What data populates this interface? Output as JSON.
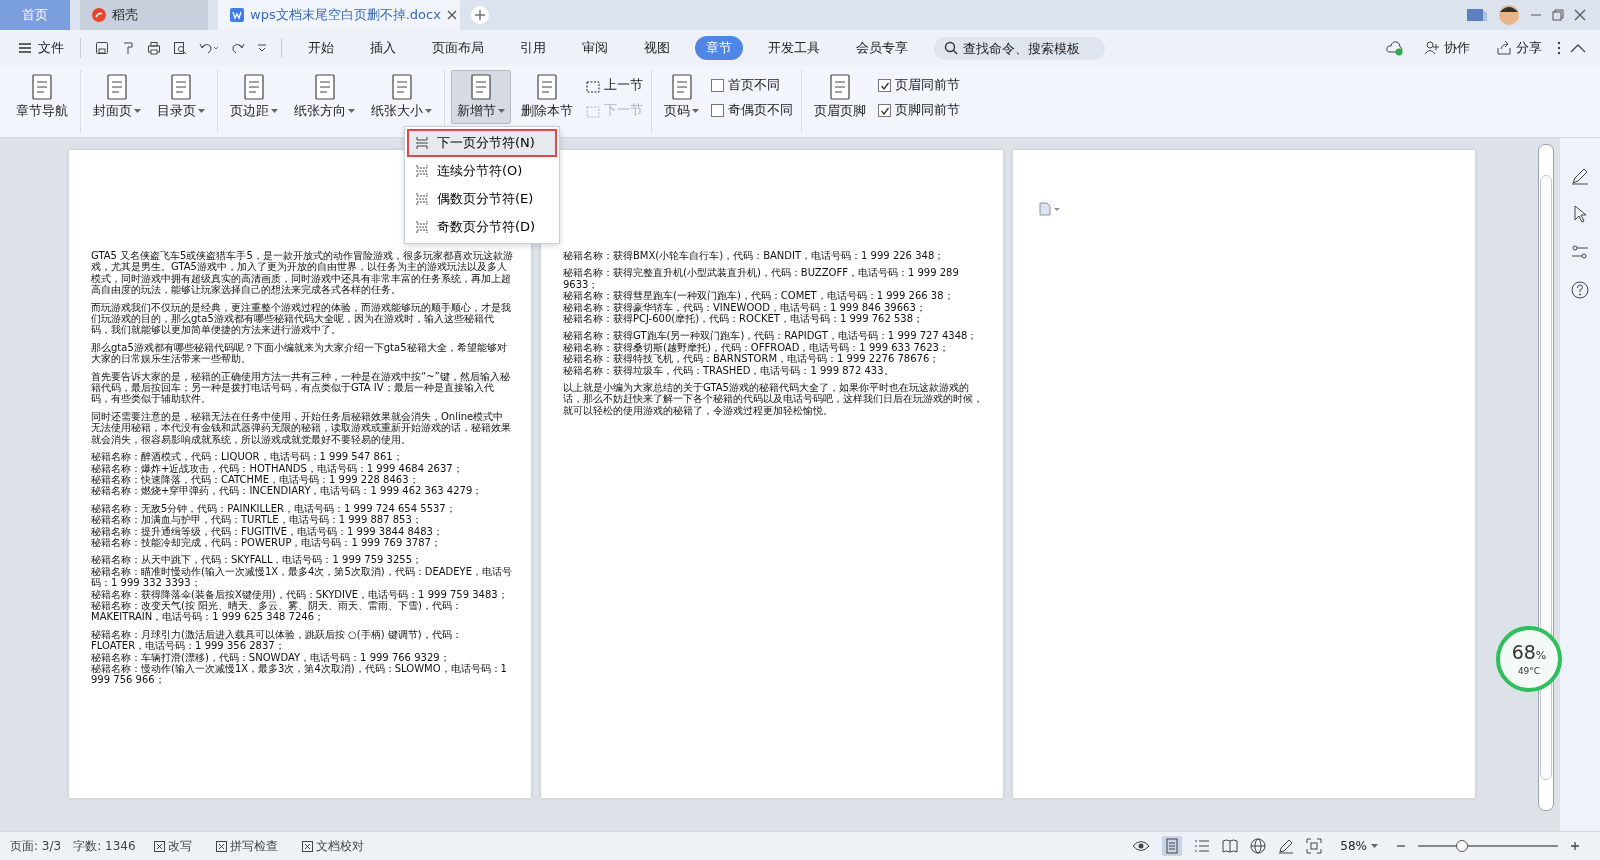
{
  "tabs": [
    {
      "label": "首页",
      "kind": "home",
      "selected": false
    },
    {
      "label": "稻壳",
      "kind": "app",
      "selected": false
    },
    {
      "label": "wps文档末尾空白页删不掉.docx",
      "kind": "doc",
      "selected": true
    }
  ],
  "file_menu": "文件",
  "menu_tabs": [
    {
      "label": "开始",
      "selected": false
    },
    {
      "label": "插入",
      "selected": false
    },
    {
      "label": "页面布局",
      "selected": false
    },
    {
      "label": "引用",
      "selected": false
    },
    {
      "label": "审阅",
      "selected": false
    },
    {
      "label": "视图",
      "selected": false
    },
    {
      "label": "章节",
      "selected": true
    },
    {
      "label": "开发工具",
      "selected": false
    },
    {
      "label": "会员专享",
      "selected": false
    }
  ],
  "search": {
    "placeholder": "查找命令、搜索模板"
  },
  "header_actions": [
    "协作",
    "分享"
  ],
  "ribbon": {
    "groups": [
      {
        "items": [
          {
            "kind": "big",
            "label": "章节导航",
            "dropdown": false,
            "pressed": false
          }
        ]
      },
      {
        "items": [
          {
            "kind": "big",
            "label": "封面页",
            "dropdown": true,
            "pressed": false
          },
          {
            "kind": "big",
            "label": "目录页",
            "dropdown": true,
            "pressed": false
          }
        ]
      },
      {
        "items": [
          {
            "kind": "big",
            "label": "页边距",
            "dropdown": true,
            "pressed": false
          },
          {
            "kind": "big",
            "label": "纸张方向",
            "dropdown": true,
            "pressed": false
          },
          {
            "kind": "big",
            "label": "纸张大小",
            "dropdown": true,
            "pressed": false
          }
        ]
      },
      {
        "items": [
          {
            "kind": "big",
            "label": "新增节",
            "dropdown": true,
            "pressed": true
          },
          {
            "kind": "big",
            "label": "删除本节",
            "dropdown": false,
            "pressed": false
          },
          {
            "kind": "stack",
            "items": [
              {
                "label": "上一节",
                "disabled": false
              },
              {
                "label": "下一节",
                "disabled": true
              }
            ]
          }
        ]
      },
      {
        "items": [
          {
            "kind": "big",
            "label": "页码",
            "dropdown": true,
            "pressed": false
          },
          {
            "kind": "checks",
            "items": [
              {
                "label": "首页不同",
                "checked": false
              },
              {
                "label": "奇偶页不同",
                "checked": false
              }
            ]
          }
        ]
      },
      {
        "items": [
          {
            "kind": "big",
            "label": "页眉页脚",
            "dropdown": false,
            "pressed": false
          },
          {
            "kind": "checks",
            "items": [
              {
                "label": "页眉同前节",
                "checked": true
              },
              {
                "label": "页脚同前节",
                "checked": true
              }
            ]
          }
        ]
      }
    ]
  },
  "dropdown_menu": [
    {
      "label": "下一页分节符(N)",
      "selected": true
    },
    {
      "label": "连续分节符(O)",
      "selected": false
    },
    {
      "label": "偶数页分节符(E)",
      "selected": false
    },
    {
      "label": "奇数页分节符(D)",
      "selected": false
    }
  ],
  "pages": [
    {
      "paragraphs": [
        [
          "GTA5 又名侠盗飞车5或侠盗猎车手5，是一款开放式的动作冒险游戏，很多玩家都喜欢玩这款游戏，尤其是男生。GTA5游戏中，加入了更为开放的自由世界，以任务为主的游戏玩法以及多人模式，同时游戏中拥有超级真实的高清画质，同时游戏中还具有非常丰富的任务系统，再加上超高自由度的玩法，能够让玩家选择自己的想法来完成各式各样的任务。"
        ],
        [
          "而玩游戏我们不仅玩的是经典，更注重整个游戏过程的体验，而游戏能够玩的顺手顺心，才是我们玩游戏的目的，那么gta5游戏都有哪些秘籍代码大全呢，因为在游戏时，输入这些秘籍代码，我们就能够以更加简单便捷的方法来进行游戏中了。"
        ],
        [
          "那么gta5游戏都有哪些秘籍代码呢？下面小编就来为大家介绍一下gta5秘籍大全，希望能够对大家的日常娱乐生活带来一些帮助。"
        ],
        [
          "首先要告诉大家的是，秘籍的正确使用方法一共有三种，一种是在游戏中按“~”键，然后输入秘籍代码，最后按回车；另一种是拨打电话号码，有点类似于GTA IV；最后一种是直接输入代码，有些类似于辅助软件。"
        ],
        [
          "同时还需要注意的是，秘籍无法在任务中使用，开始任务后秘籍效果就会消失，Online模式中无法使用秘籍，本代没有金钱和武器弹药无限的秘籍，读取游戏或重新开始游戏的话，秘籍效果就会消失，很容易影响成就系统，所以游戏成就党最好不要轻易的使用。"
        ],
        [
          "秘籍名称：醉酒模式，代码：LIQUOR，电话号码：1 999 547 861；",
          "秘籍名称：爆炸+近战攻击，代码：HOTHANDS，电话号码：1 999 4684 2637；",
          "秘籍名称：快速降落，代码：CATCHME，电话号码：1 999 228 8463；",
          "秘籍名称：燃烧+穿甲弹药，代码：INCENDIARY，电话号码：1 999 462 363 4279；"
        ],
        [
          "秘籍名称：无敌5分钟，代码：PAINKILLER，电话号码：1 999 724 654 5537；",
          "秘籍名称：加满血与护甲，代码：TURTLE，电话号码：1 999 887 853；",
          "秘籍名称：提升通缉等级，代码：FUGITIVE，电话号码：1 999 3844 8483；",
          "秘籍名称：技能冷却完成，代码：POWERUP，电话号码：1 999 769 3787；"
        ],
        [
          "秘籍名称：从天中跳下，代码：SKYFALL，电话号码：1 999 759 3255；",
          "秘籍名称：瞄准时慢动作(输入一次减慢1X，最多4次，第5次取消)，代码：DEADEYE，电话号码：1 999 332 3393；",
          "秘籍名称：获得降落伞(装备后按X键使用)，代码：SKYDIVE，电话号码：1 999 759 3483；",
          "秘籍名称：改变天气(按 阳光、晴天、多云、雾、阴天、雨天、雷雨、下雪)，代码：MAKEITRAIN，电话号码：1 999 625 348 7246；"
        ],
        [
          "秘籍名称：月球引力(激活后进入载具可以体验，跳跃后按 ○(手柄) 键调节)，代码：FLOATER，电话号码：1 999 356 2837；",
          "秘籍名称：车辆打滑(漂移)，代码：SNOWDAY，电话号码：1 999 766 9329；",
          "秘籍名称：慢动作(输入一次减慢1X，最多3次，第4次取消)，代码：SLOWMO，电话号码：1 999 756 966；"
        ]
      ]
    },
    {
      "paragraphs": [
        [
          "秘籍名称：获得BMX(小轮车自行车)，代码：BANDIT，电话号码：1 999 226 348；"
        ],
        [
          "秘籍名称：获得完整直升机(小型武装直升机)，代码：BUZZOFF，电话号码：1 999 289 9633；",
          "秘籍名称：获得彗星跑车(一种双门跑车)，代码：COMET，电话号码：1 999 266 38；",
          "秘籍名称：获得豪华轿车，代码：VINEWOOD，电话号码：1 999 846 39663；",
          "秘籍名称：获得PCJ-600(摩托)，代码：ROCKET，电话号码：1 999 762 538；"
        ],
        [
          "秘籍名称：获得GT跑车(另一种双门跑车)，代码：RAPIDGT，电话号码：1 999 727 4348；",
          "秘籍名称：获得桑切斯(越野摩托)，代码：OFFROAD，电话号码：1 999 633 7623；",
          "秘籍名称：获得特技飞机，代码：BARNSTORM，电话号码：1 999 2276 78676；",
          "秘籍名称：获得垃圾车，代码：TRASHED，电话号码：1 999 872 433。"
        ],
        [
          "以上就是小编为大家总结的关于GTA5游戏的秘籍代码大全了，如果你平时也在玩这款游戏的话，那么不妨赶快来了解一下各个秘籍的代码以及电话号码吧，这样我们日后在玩游戏的时候，就可以轻松的使用游戏的秘籍了，令游戏过程更加轻松愉悦。"
        ]
      ]
    },
    {
      "paste_options": true
    }
  ],
  "temperature": {
    "value": "68",
    "unit": "%",
    "temp": "49°C"
  },
  "status": {
    "page": "页面: 3/3",
    "words": "字数: 1346",
    "toggles": [
      "改写",
      "拼写检查",
      "文档校对"
    ],
    "zoom": "58%",
    "zoom_slider": {
      "level": 0.3
    }
  }
}
